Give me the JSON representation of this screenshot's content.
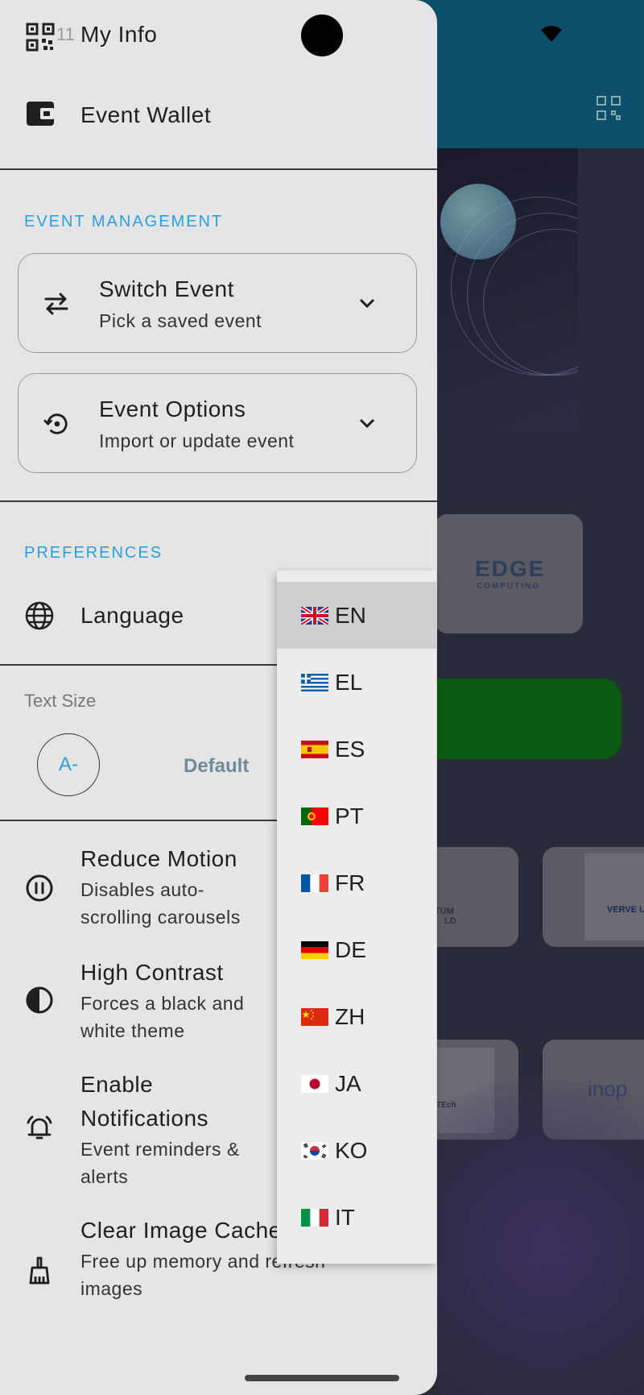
{
  "status": {
    "time": "11"
  },
  "drawer": {
    "my_info": "My Info",
    "event_wallet": "Event Wallet",
    "event_management_label": "EVENT MANAGEMENT",
    "switch_event": {
      "title": "Switch Event",
      "subtitle": "Pick a saved event"
    },
    "event_options": {
      "title": "Event Options",
      "subtitle": "Import or update event"
    },
    "preferences_label": "PREFERENCES",
    "language_label": "Language",
    "text_size_label": "Text Size",
    "text_size_decrease": "A-",
    "text_size_value": "Default",
    "reduce_motion": {
      "title": "Reduce Motion",
      "subtitle": "Disables auto-scrolling carousels"
    },
    "high_contrast": {
      "title": "High Contrast",
      "subtitle": "Forces a black and white theme"
    },
    "notifications": {
      "title": "Enable Notifications",
      "subtitle": "Event reminders & alerts"
    },
    "clear_cache": {
      "title": "Clear Image Cache",
      "subtitle": "Free up memory and refresh images"
    }
  },
  "language_dropdown": {
    "selected": "EN",
    "options": [
      {
        "code": "EN",
        "flag": "uk-flag-icon"
      },
      {
        "code": "EL",
        "flag": "greece-flag-icon"
      },
      {
        "code": "ES",
        "flag": "spain-flag-icon"
      },
      {
        "code": "PT",
        "flag": "portugal-flag-icon"
      },
      {
        "code": "FR",
        "flag": "france-flag-icon"
      },
      {
        "code": "DE",
        "flag": "germany-flag-icon"
      },
      {
        "code": "ZH",
        "flag": "china-flag-icon"
      },
      {
        "code": "JA",
        "flag": "japan-flag-icon"
      },
      {
        "code": "KO",
        "flag": "korea-flag-icon"
      },
      {
        "code": "IT",
        "flag": "italy-flag-icon"
      }
    ]
  },
  "background": {
    "sponsor_1": "EDGE",
    "sponsor_1_sub": "COMPUTING",
    "sponsor_2": "TUM",
    "sponsor_2b": "LD",
    "sponsor_3": "VERVE U",
    "sponsor_4": "TEch",
    "sponsor_5": "inop"
  },
  "colors": {
    "accent": "#2a9fe0",
    "drawer_bg": "#e5e5e5",
    "header": "#0d4f6b",
    "green_button": "#0b5a12"
  }
}
